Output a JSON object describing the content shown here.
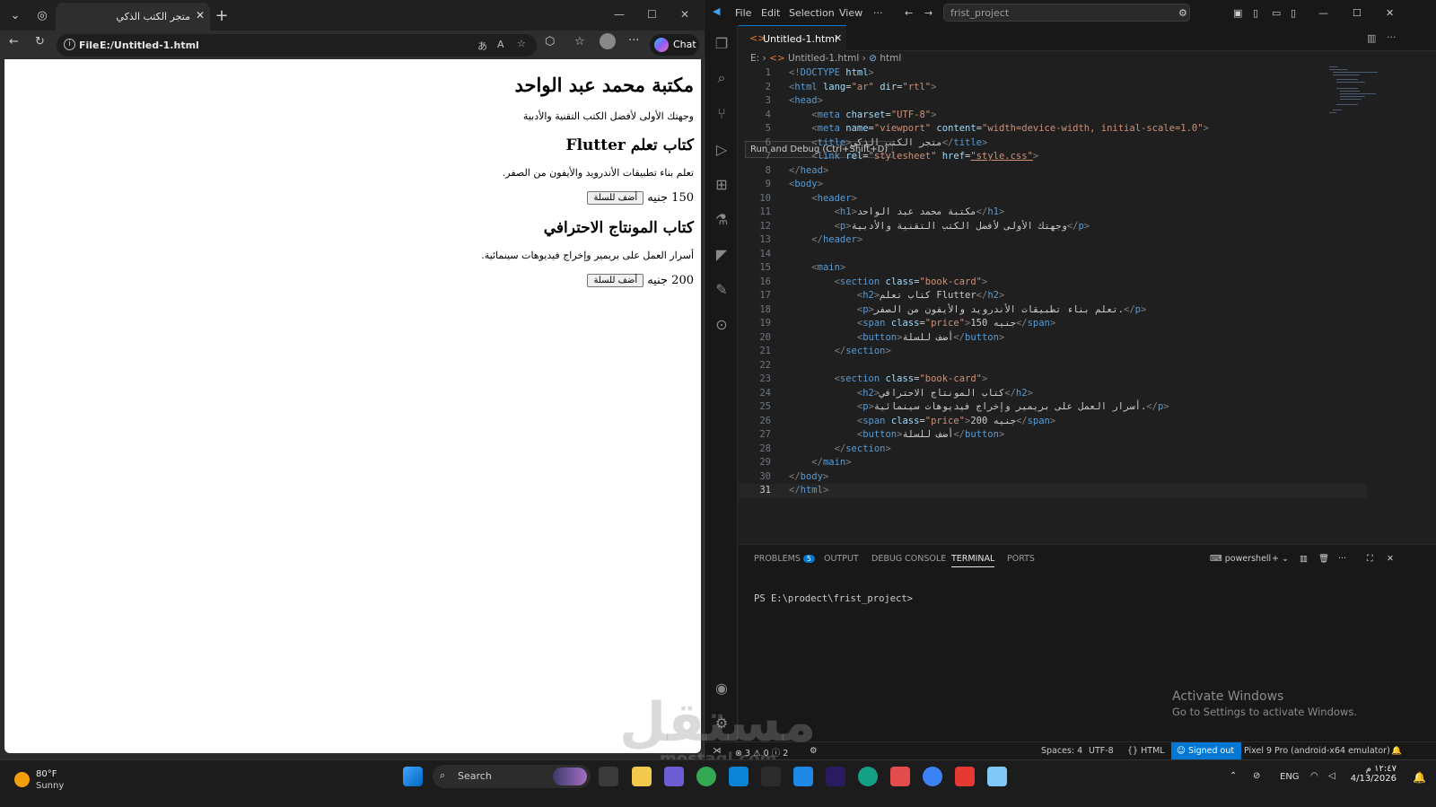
{
  "browser": {
    "tab_title": "متجر الكتب الذكي",
    "url_label": "File",
    "url": "E:/Untitled-1.html",
    "chat_label": "Chat",
    "page": {
      "h1": "مكتبة محمد عبد الواحد",
      "intro": "وجهتك الأولى لأفضل الكتب التقنية والأدبية",
      "books": [
        {
          "title": "كتاب تعلم Flutter",
          "desc": "تعلم بناء تطبيقات الأندرويد والأيفون من الصفر.",
          "price": "150 جنيه",
          "button": "أضف للسلة"
        },
        {
          "title": "كتاب المونتاج الاحترافي",
          "desc": "أسرار العمل على بريمير وإخراج فيديوهات سينمائية.",
          "price": "200 جنيه",
          "button": "أضف للسلة"
        }
      ]
    }
  },
  "vscode": {
    "menu": [
      "File",
      "Edit",
      "Selection",
      "View",
      "···"
    ],
    "search_text": "frist_project",
    "tab_name": "Untitled-1.html",
    "breadcrumb": [
      "E:",
      "Untitled-1.html",
      "html"
    ],
    "tooltip": "Run and Debug (Ctrl+Shift+D)",
    "panel_tabs": [
      "PROBLEMS",
      "OUTPUT",
      "DEBUG CONSOLE",
      "TERMINAL",
      "PORTS"
    ],
    "problems_count": "5",
    "terminal_shell": "powershell",
    "prompt": "PS E:\\prodect\\frist_project>",
    "activate_title": "Activate Windows",
    "activate_sub": "Go to Settings to activate Windows.",
    "status": {
      "errors": "3",
      "warnings": "0",
      "info": "2",
      "spaces": "Spaces: 4",
      "encoding": "UTF-8",
      "language": "HTML",
      "signed": "Signed out",
      "device": "Pixel 9 Pro (android-x64 emulator)"
    }
  },
  "taskbar": {
    "temp": "80°F",
    "weather": "Sunny",
    "search": "Search",
    "lang": "ENG",
    "time": "١٢:٤٧ م",
    "date": "4/13/2026"
  },
  "watermark": "مستقل",
  "watermark_sub": "mostaql.com"
}
